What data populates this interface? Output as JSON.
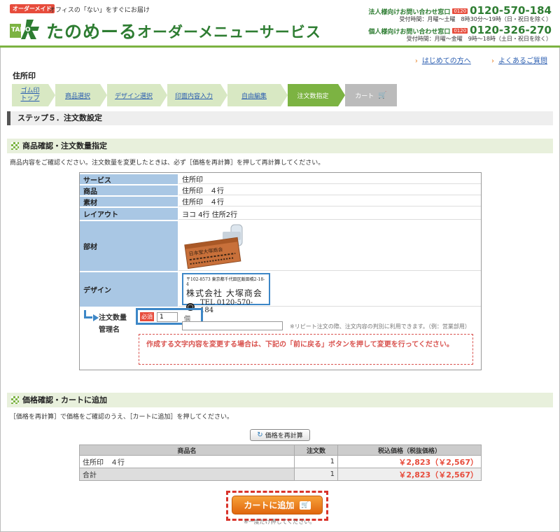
{
  "header": {
    "badge": "オーダーメイド",
    "tagline": "オフィスの「ない」をすぐにお届け",
    "logo_small": "TANO",
    "logo": "たのめーる",
    "service": "オーダーメニューサービス",
    "corp_contact": {
      "label": "法人様向けお問い合わせ窓口",
      "free": "0120",
      "tel": "0120-570-184",
      "hours": "受付時間：月曜～土曜　8時30分～19時（日・祝日を除く）"
    },
    "personal_contact": {
      "label": "個人様向けお問い合わせ窓口",
      "free": "0120",
      "tel": "0120-326-270",
      "hours": "受付時間：月曜～金曜　9時～18時（土日・祝日を除く）"
    }
  },
  "toplinks": [
    "はじめての方へ",
    "よくあるご質問"
  ],
  "page_title": "住所印",
  "steps": [
    {
      "line1": "ゴム印",
      "line2": "トップ"
    },
    {
      "label": "商品選択"
    },
    {
      "label": "デザイン選択"
    },
    {
      "label": "印面内容入力"
    },
    {
      "label": "自由編集"
    },
    {
      "label": "注文数指定"
    },
    {
      "label": "カート"
    }
  ],
  "step_heading": "ステップ５．注文数設定",
  "product_section": {
    "title": "商品確認・注文数量指定",
    "note": "商品内容をご確認ください。注文数量を変更したときは、必ず［価格を再計算］を押して再計算してください。",
    "rows": [
      {
        "key": "サービス",
        "value": "住所印"
      },
      {
        "key": "商品",
        "value": "住所印　４行"
      },
      {
        "key": "素材",
        "value": "住所印　４行"
      },
      {
        "key": "レイアウト",
        "value": "ヨコ 4行 住所2行"
      },
      {
        "key": "部材",
        "value": ""
      },
      {
        "key": "デザイン",
        "value": ""
      }
    ],
    "stamp_text": "日本堂大塚商会",
    "design": {
      "address": "〒102-8573 東京都千代田区飯田橋2-18-4",
      "company": "株式会社 大塚商会",
      "tel": "TEL 0120-570-184"
    },
    "qty_label": "注文数量",
    "required": "必須",
    "qty_value": "1",
    "qty_unit": "個",
    "name_label": "管理名",
    "name_hint": "※リピート注文の際、注文内容の判別に利用できます。（例：営業部用）",
    "warning": "作成する文字内容を変更する場合は、下記の「前に戻る」ボタンを押して変更を行ってください。"
  },
  "price_section": {
    "title": "価格確認・カートに追加",
    "note": "［価格を再計算］で価格をご確認のうえ、［カートに追加］を押してください。",
    "recalc_label": "価格を再計算",
    "headers": [
      "商品名",
      "注文数",
      "税込価格（税抜価格）"
    ],
    "rows": [
      {
        "name": "住所印　４行",
        "qty": "1",
        "price": "￥2,823（￥2,567）"
      },
      {
        "name": "合計",
        "qty": "1",
        "price": "￥2,823（￥2,567）"
      }
    ],
    "cart_label": "カートに追加",
    "cart_icon": "cart-icon",
    "cart_note": "※一度だけ押してください。"
  },
  "colors": {
    "brand_green": "#2e7d32",
    "accent_green": "#7cb342",
    "key_blue": "#a9c7e4",
    "highlight_blue": "#3d87c7",
    "price_red": "#e74c3c",
    "cart_orange": "#e0660d"
  }
}
